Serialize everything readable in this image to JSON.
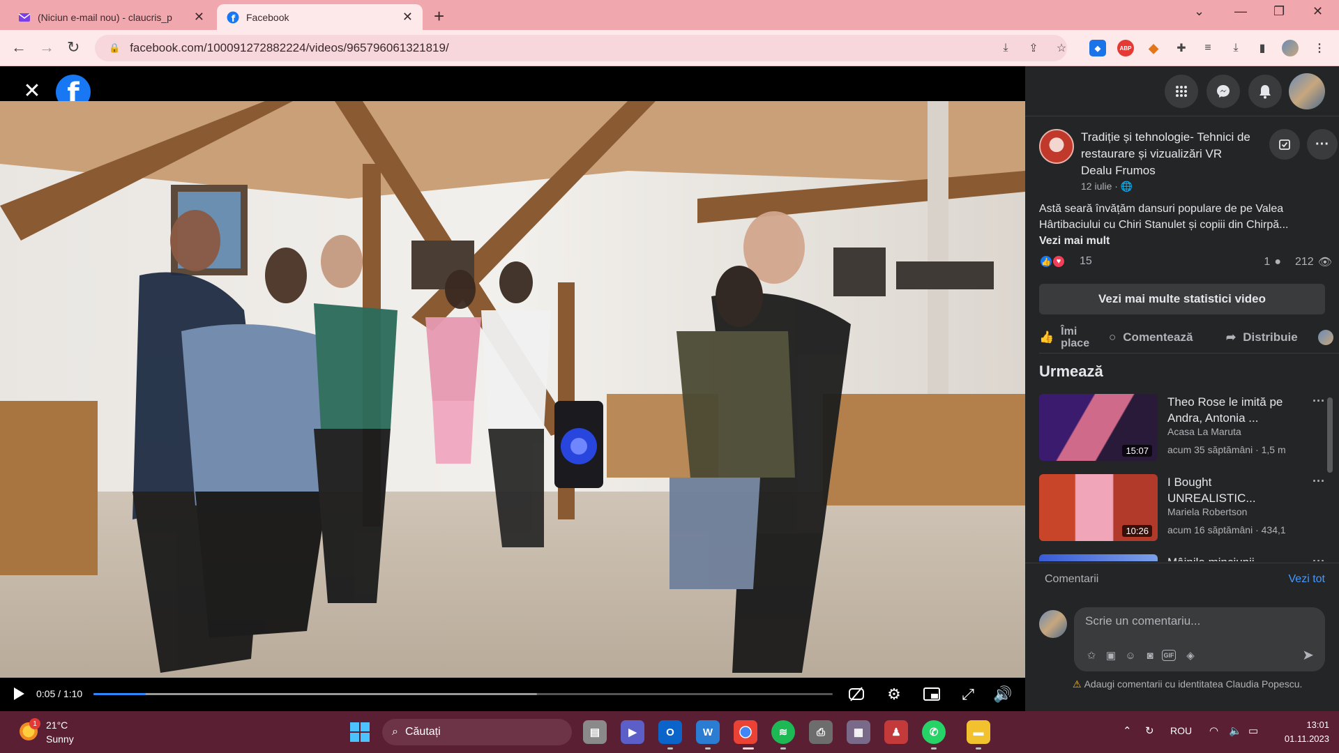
{
  "browser": {
    "tabs": [
      {
        "title": "(Niciun e-mail nou) - claucris_p",
        "favicon": "gmail-icon"
      },
      {
        "title": "Facebook",
        "favicon": "facebook-icon"
      }
    ],
    "url": "facebook.com/100091272882224/videos/965796061321819/"
  },
  "video": {
    "time_current": "0:05",
    "time_total": "1:10",
    "progress": 0.071,
    "buffered": 0.6
  },
  "post": {
    "page_name": "Tradiție și tehnologie- Tehnici de restaurare și vizualizări VR Dealu Frumos",
    "date": "12 iulie",
    "text_line1": "Astă seară învățăm dansuri populare de pe Valea",
    "text_line2": "Hârtibaciului cu Chiri Stanulet și copiii din Chirpă...",
    "see_more": "Vezi mai mult",
    "reaction_count": "15",
    "comment_count": "1",
    "view_count": "212",
    "stats_button": "Vezi mai multe statistici video",
    "like_label": "Îmi place",
    "comment_label": "Comentează",
    "share_label": "Distribuie"
  },
  "up_next": {
    "heading": "Urmează",
    "items": [
      {
        "title": "Theo Rose le imită pe Andra, Antonia ...",
        "channel": "Acasa La Maruta",
        "meta": "acum 35 săptămâni · 1,5 m",
        "duration": "15:07"
      },
      {
        "title": "I Bought UNREALISTIC...",
        "channel": "Mariela Robertson",
        "meta": "acum 16 săptămâni · 434,1",
        "duration": "10:26"
      },
      {
        "title": "Mâinile minciunii",
        "channel": "",
        "meta": "",
        "duration": ""
      }
    ]
  },
  "comments": {
    "label": "Comentarii",
    "see_all": "Vezi tot",
    "placeholder": "Scrie un comentariu...",
    "identity_note": "Adaugi comentarii cu identitatea Claudia Popescu."
  },
  "taskbar": {
    "temperature": "21°C",
    "weather": "Sunny",
    "weather_badge": "1",
    "search_label": "Căutați",
    "language": "ROU",
    "time": "13:01",
    "date": "01.11.2023"
  },
  "colors": {
    "tab_strip": "#f0a8ae",
    "toolbar": "#fde8ea",
    "sidebar": "#242526",
    "accent_blue": "#2d88ff",
    "taskbar": "#5a1f33"
  }
}
